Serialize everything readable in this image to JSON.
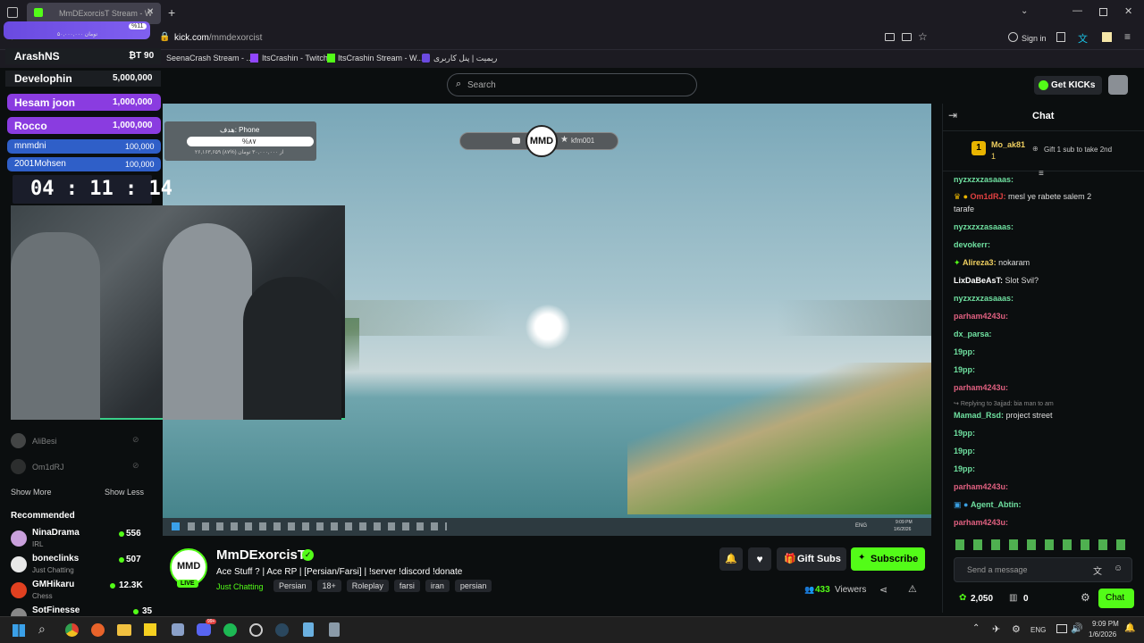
{
  "browser": {
    "tab_title": "MmDExorcisT Stream - W",
    "new_tab": "+",
    "url_domain": "kick.com",
    "url_path": "/mmdexorcist",
    "signin": "Sign in",
    "bookmarks": [
      "SeenaCrash Stream - ...",
      "ItsCrashin - Twitch",
      "ItsCrashin Stream - W...",
      "ریمیت | پنل کاربری"
    ]
  },
  "overlay": {
    "badge": "%11",
    "goal_amount": "۵۰,۰۰۰,۰۰۰ تومان",
    "leaderboard": [
      {
        "name": "ArashNS",
        "amount": "₿T 90"
      },
      {
        "name": "Develophin",
        "amount": "5,000,000"
      },
      {
        "name": "Hesam joon",
        "amount": "1,000,000"
      },
      {
        "name": "Rocco",
        "amount": "1,000,000"
      },
      {
        "name": "mnmdni",
        "amount": "100,000"
      },
      {
        "name": "2001Mohsen",
        "amount": "100,000"
      }
    ],
    "timer": "04 : 11 : 14",
    "phone_goal": {
      "title": "هدف: Phone",
      "percent": "%۸۷",
      "detail": "۲۶,۱۶۳,۶۵۹ از ۳۰,۰۰۰,۰۰۰ تومان (%۸۷)"
    },
    "mmd_pill": {
      "left": "",
      "right": "kfm001",
      "logo": "MMD"
    }
  },
  "sidebar": {
    "followed": [
      {
        "name": "AliBesi"
      },
      {
        "name": "Om1dRJ"
      }
    ],
    "show_more": "Show More",
    "show_less": "Show Less",
    "recommended_title": "Recommended",
    "recommended": [
      {
        "name": "NinaDrama",
        "category": "IRL",
        "viewers": "556",
        "color": "#c9a0dc"
      },
      {
        "name": "boneclinks",
        "category": "Just Chatting",
        "viewers": "507",
        "color": "#e8e8e8"
      },
      {
        "name": "GMHikaru",
        "category": "Chess",
        "viewers": "12.3K",
        "color": "#e04020"
      },
      {
        "name": "SotFinesse",
        "category": "",
        "viewers": "35",
        "color": "#888"
      }
    ]
  },
  "kick": {
    "search_placeholder": "Search",
    "get_kicks": "Get KICKs"
  },
  "stream": {
    "channel": "MmDExorcisT",
    "title": "Ace Stuff ? | Ace RP | [Persian/Farsi] | !server !discord !donate",
    "category": "Just Chatting",
    "tags": [
      "Persian",
      "18+",
      "Roleplay",
      "farsi",
      "iran",
      "persian"
    ],
    "live": "LIVE",
    "avatar_text": "MMD",
    "gift_subs": "Gift Subs",
    "subscribe": "Subscribe",
    "viewers": "433",
    "viewers_label": "Viewers"
  },
  "chat": {
    "title": "Chat",
    "top_gifter": {
      "name": "Mo_ak81",
      "count": "1",
      "rank": "1",
      "cta": "Gift 1 sub to take 2nd"
    },
    "messages": [
      {
        "user": "nyzxzxzasaaas:",
        "text": "",
        "color": "#6fe0a0"
      },
      {
        "user": "Om1dRJ:",
        "text": "mesl ye rabete salem 2",
        "text2": "tarafe",
        "color": "#e04040"
      },
      {
        "user": "nyzxzxzasaaas:",
        "text": "",
        "color": "#6fe0a0"
      },
      {
        "user": "devokerr:",
        "text": "",
        "color": "#6fe0a0"
      },
      {
        "user": "Alireza3:",
        "text": "nokaram",
        "color": "#f0d060"
      },
      {
        "user": "LixDaBeAsT:",
        "text": "Slot Svil?",
        "color": "#ffffff"
      },
      {
        "user": "nyzxzxzasaaas:",
        "text": "",
        "color": "#6fe0a0"
      },
      {
        "user": "parham4243u:",
        "text": "",
        "color": "#e06080"
      },
      {
        "user": "dx_parsa:",
        "text": "",
        "color": "#6fe0a0"
      },
      {
        "user": "19pp:",
        "text": "",
        "color": "#6fe0a0"
      },
      {
        "user": "19pp:",
        "text": "",
        "color": "#6fe0a0"
      },
      {
        "user": "parham4243u:",
        "text": "",
        "color": "#e06080"
      },
      {
        "user": "Mamad_Rsd:",
        "text": "project street",
        "color": "#6fe0a0",
        "reply": "Replying to 3ajjad: bia man to am"
      },
      {
        "user": "19pp:",
        "text": "",
        "color": "#6fe0a0"
      },
      {
        "user": "19pp:",
        "text": "",
        "color": "#6fe0a0"
      },
      {
        "user": "19pp:",
        "text": "",
        "color": "#6fe0a0"
      },
      {
        "user": "parham4243u:",
        "text": "",
        "color": "#e06080"
      },
      {
        "user": "Agent_Abtin:",
        "text": "",
        "color": "#6fe0a0"
      },
      {
        "user": "parham4243u:",
        "text": "",
        "color": "#e06080"
      }
    ],
    "input_placeholder": "Send a message",
    "points": "2,050",
    "kicks": "0",
    "send": "Chat"
  },
  "player_taskbar": {
    "lang": "ENG",
    "time": "9:09 PM",
    "date": "1/6/2026"
  },
  "taskbar": {
    "lang": "ENG",
    "time": "9:09 PM",
    "date": "1/6/2026",
    "discord_badge": "99+"
  },
  "colors": {
    "kick_green": "#53fc18",
    "bg": "#0b0e0f"
  }
}
